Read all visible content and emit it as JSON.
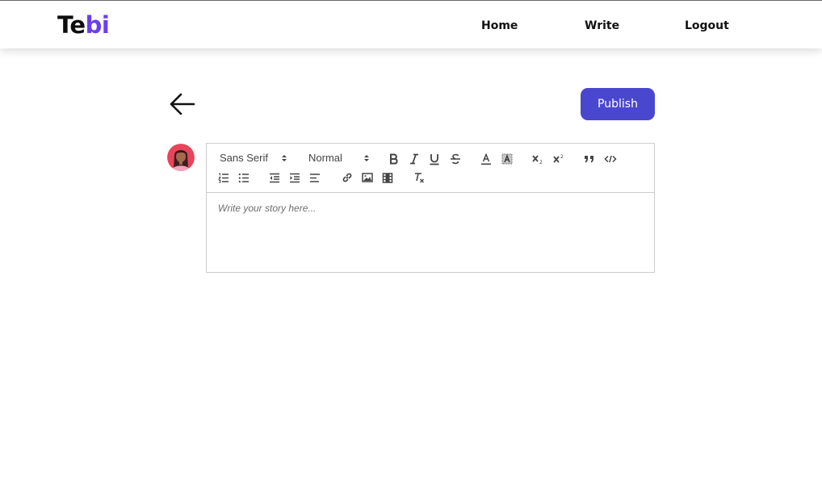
{
  "header": {
    "logo": {
      "part1": "Te",
      "part2": "bi"
    },
    "nav": {
      "home": "Home",
      "write": "Write",
      "logout": "Logout"
    }
  },
  "actions": {
    "publish_label": "Publish"
  },
  "editor": {
    "font_select": "Sans Serif",
    "size_select": "Normal",
    "placeholder": "Write your story here..."
  },
  "colors": {
    "brand_accent": "#6a3ef0",
    "publish_button": "#4a47cf",
    "avatar_background": "#e8445a"
  },
  "icons": [
    "back-arrow-icon",
    "bold-icon",
    "italic-icon",
    "underline-icon",
    "strikethrough-icon",
    "font-color-icon",
    "background-color-icon",
    "subscript-icon",
    "superscript-icon",
    "blockquote-icon",
    "code-block-icon",
    "ordered-list-icon",
    "bullet-list-icon",
    "outdent-icon",
    "indent-icon",
    "align-left-icon",
    "link-icon",
    "image-icon",
    "video-icon",
    "clear-format-icon"
  ]
}
